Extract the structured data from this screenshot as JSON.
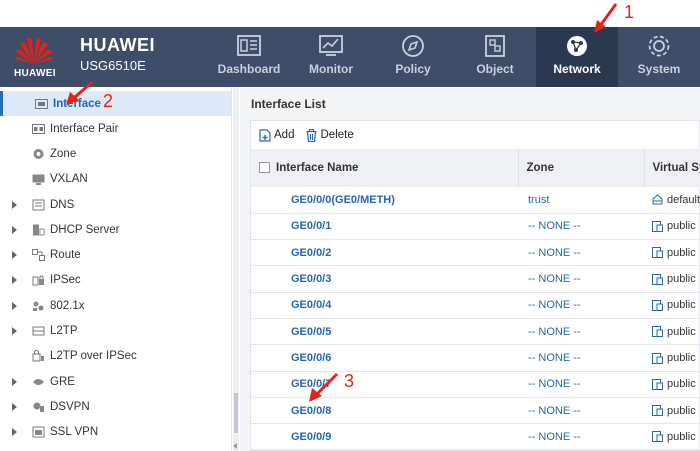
{
  "brand": {
    "logo_text": "HUAWEI",
    "name": "HUAWEI",
    "model": "USG6510E"
  },
  "nav": [
    {
      "label": "Dashboard",
      "icon": "dashboard-icon"
    },
    {
      "label": "Monitor",
      "icon": "monitor-icon"
    },
    {
      "label": "Policy",
      "icon": "policy-icon"
    },
    {
      "label": "Object",
      "icon": "object-icon"
    },
    {
      "label": "Network",
      "icon": "network-icon",
      "active": true
    },
    {
      "label": "System",
      "icon": "system-icon"
    }
  ],
  "sidebar": {
    "items": [
      {
        "label": "Interface",
        "icon": "interface-icon",
        "active": true
      },
      {
        "label": "Interface Pair",
        "icon": "interface-pair-icon"
      },
      {
        "label": "Zone",
        "icon": "zone-icon"
      },
      {
        "label": "VXLAN",
        "icon": "vxlan-icon"
      },
      {
        "label": "DNS",
        "icon": "dns-icon",
        "expandable": true
      },
      {
        "label": "DHCP Server",
        "icon": "dhcp-server-icon",
        "expandable": true
      },
      {
        "label": "Route",
        "icon": "route-icon",
        "expandable": true
      },
      {
        "label": "IPSec",
        "icon": "ipsec-icon",
        "expandable": true
      },
      {
        "label": "802.1x",
        "icon": "dot1x-icon",
        "expandable": true
      },
      {
        "label": "L2TP",
        "icon": "l2tp-icon",
        "expandable": true
      },
      {
        "label": "L2TP over IPSec",
        "icon": "l2tp-over-ipsec-icon"
      },
      {
        "label": "GRE",
        "icon": "gre-icon",
        "expandable": true
      },
      {
        "label": "DSVPN",
        "icon": "dsvpn-icon",
        "expandable": true
      },
      {
        "label": "SSL VPN",
        "icon": "ssl-vpn-icon",
        "expandable": true
      }
    ]
  },
  "main": {
    "title": "Interface List",
    "toolbar": {
      "add_label": "Add",
      "delete_label": "Delete"
    },
    "columns": [
      "Interface Name",
      "Zone",
      "Virtual Sys"
    ],
    "rows": [
      {
        "name": "GE0/0/0(GE0/METH)",
        "zone": "trust",
        "vsys": "default"
      },
      {
        "name": "GE0/0/1",
        "zone": "-- NONE --",
        "vsys": "public"
      },
      {
        "name": "GE0/0/2",
        "zone": "-- NONE --",
        "vsys": "public"
      },
      {
        "name": "GE0/0/3",
        "zone": "-- NONE --",
        "vsys": "public"
      },
      {
        "name": "GE0/0/4",
        "zone": "-- NONE --",
        "vsys": "public"
      },
      {
        "name": "GE0/0/5",
        "zone": "-- NONE --",
        "vsys": "public"
      },
      {
        "name": "GE0/0/6",
        "zone": "-- NONE --",
        "vsys": "public"
      },
      {
        "name": "GE0/0/7",
        "zone": "-- NONE --",
        "vsys": "public"
      },
      {
        "name": "GE0/0/8",
        "zone": "-- NONE --",
        "vsys": "public"
      },
      {
        "name": "GE0/0/9",
        "zone": "-- NONE --",
        "vsys": "public"
      }
    ]
  },
  "annotations": {
    "one": "1",
    "two": "2",
    "three": "3"
  },
  "colors": {
    "topbar": "#3e4d68",
    "topbar_active": "#2b3950",
    "link": "#2466b4",
    "annotation": "#e2231a"
  }
}
